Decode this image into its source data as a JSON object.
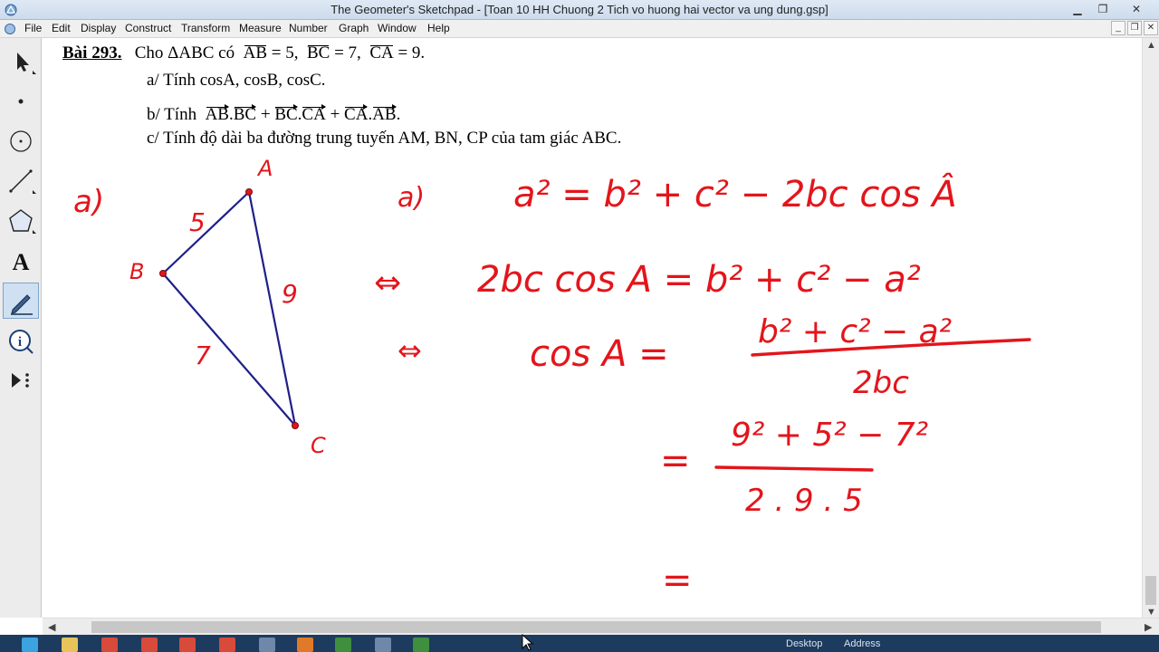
{
  "window": {
    "title": "The Geometer's Sketchpad - [Toan 10 HH Chuong 2 Tich vo huong hai vector va ung dung.gsp]",
    "controls": [
      "minimize-icon",
      "restore-icon",
      "close-icon"
    ]
  },
  "menu": {
    "items": [
      "File",
      "Edit",
      "Display",
      "Construct",
      "Transform",
      "Measure",
      "Number",
      "Graph",
      "Window",
      "Help"
    ]
  },
  "toolbox": {
    "tools": [
      "arrow-select-tool",
      "point-tool",
      "compass-tool",
      "straightedge-tool",
      "polygon-tool",
      "text-tool",
      "marker-tool",
      "information-tool",
      "custom-tools"
    ],
    "selected": "marker-tool"
  },
  "problem": {
    "label": "Bài 293.",
    "intro": "Cho ΔABC có",
    "given": [
      {
        "seg": "AB",
        "val": "= 5,"
      },
      {
        "seg": "BC",
        "val": "= 7,"
      },
      {
        "seg": "CA",
        "val": "= 9."
      }
    ],
    "part_a": "a/  Tính cosA, cosB, cosC.",
    "part_b_prefix": "b/  Tính",
    "part_b_terms": [
      "AB",
      "BC",
      "BC",
      "CA",
      "CA",
      "AB"
    ],
    "part_b_plus": "+",
    "part_c": "c/  Tính độ dài ba đường trung tuyến AM, BN, CP của tam giác ABC."
  },
  "triangle": {
    "vertex_labels": [
      "A",
      "B",
      "C"
    ],
    "side_labels": [
      "5",
      "9",
      "7"
    ],
    "line_color": "#1f1f8a",
    "point_color": "#e3151b"
  },
  "handwriting": {
    "color": "#e3151b",
    "part_label_left": "a)",
    "part_label_right": "a)",
    "formula": "a² = b² + c² − 2bc cos Â",
    "step1_sign": "⇔",
    "step1": "2bc cos A = b² + c² − a²",
    "step2_sign": "⇔",
    "step2_lhs": "cos A =",
    "step2_num": "b² + c² − a²",
    "step2_den": "2bc",
    "step3_eq": "=",
    "step3_num": "9² + 5² − 7²",
    "step3_den": "2 . 9 . 5",
    "step4_eq": "="
  },
  "taskbar": {
    "items": [
      "Desktop",
      "Address"
    ]
  }
}
